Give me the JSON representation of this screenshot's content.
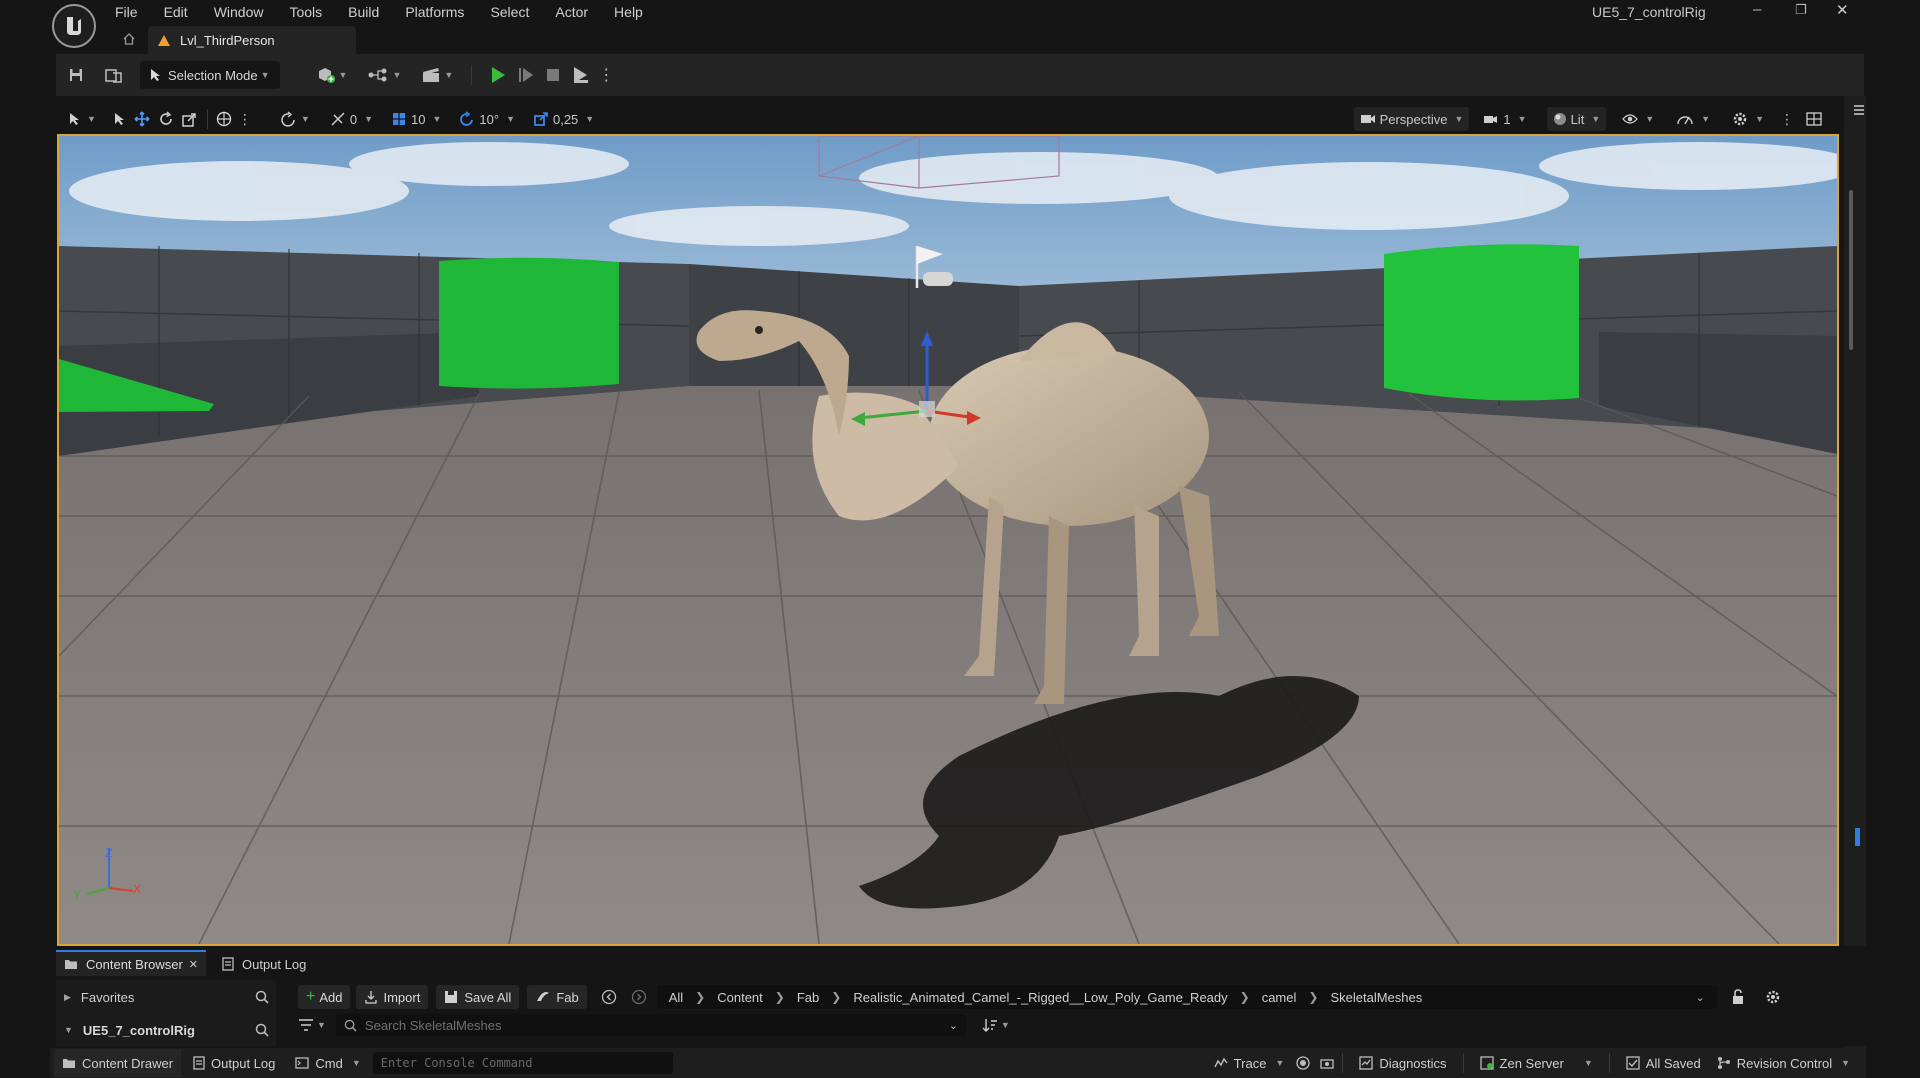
{
  "window": {
    "title": "UE5_7_controlRig",
    "minimize_glyph": "–",
    "restore_glyph": "❐",
    "close_glyph": "✕"
  },
  "menu": [
    "File",
    "Edit",
    "Window",
    "Tools",
    "Build",
    "Platforms",
    "Select",
    "Actor",
    "Help"
  ],
  "level_tab": {
    "label": "Lvl_ThirdPerson"
  },
  "toolbar": {
    "selection_mode_label": "Selection Mode"
  },
  "viewport_toolbar": {
    "angle_snap_value": "0",
    "grid_snap_value": "10",
    "rotation_snap_value": "10°",
    "scale_snap_value": "0,25",
    "view_mode_label": "Perspective",
    "camera_speed_value": "1",
    "lighting_label": "Lit"
  },
  "axis_indicator": {
    "z": "Z",
    "x": "X",
    "y": "Y"
  },
  "colors": {
    "accent_orange": "#f0a030",
    "play_green": "#3cba3c",
    "sky_top": "#6f9cc8",
    "floor": "#8c8787",
    "wall": "#4a4d52",
    "pillar_green": "#1fbf3a"
  },
  "bottom_tabs": {
    "content_browser": "Content Browser",
    "output_log": "Output Log"
  },
  "content_browser": {
    "favorites_label": "Favorites",
    "project_label": "UE5_7_controlRig",
    "add_label": "Add",
    "import_label": "Import",
    "save_all_label": "Save All",
    "fab_label": "Fab",
    "breadcrumbs": [
      "All",
      "Content",
      "Fab",
      "Realistic_Animated_Camel_-_Rigged__Low_Poly_Game_Ready",
      "camel",
      "SkeletalMeshes"
    ],
    "search_placeholder": "Search SkeletalMeshes"
  },
  "status_bar": {
    "content_drawer": "Content Drawer",
    "output_log": "Output Log",
    "cmd": "Cmd",
    "console_placeholder": "Enter Console Command",
    "trace": "Trace",
    "diagnostics": "Diagnostics",
    "zen_server": "Zen Server",
    "all_saved": "All Saved",
    "revision_control": "Revision Control"
  }
}
